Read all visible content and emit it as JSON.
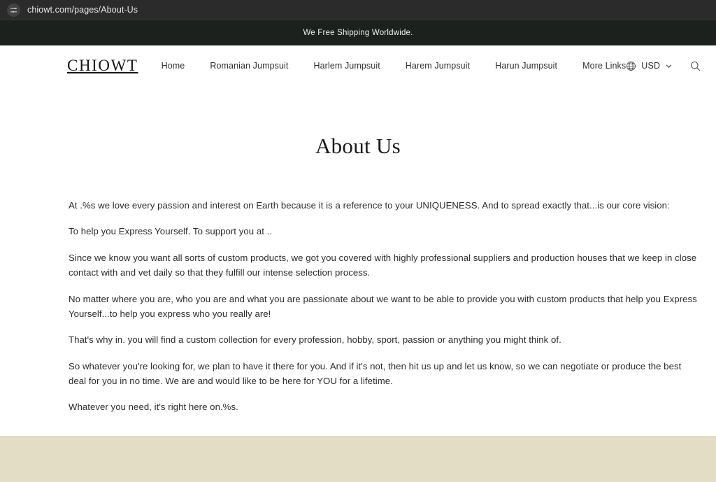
{
  "browser": {
    "url": "chiowt.com/pages/About-Us",
    "url_icon": "sliders-icon"
  },
  "announcement": {
    "text": "We Free Shipping Worldwide."
  },
  "header": {
    "logo": "CHIOWT",
    "nav": [
      {
        "label": "Home"
      },
      {
        "label": "Romanian Jumpsuit"
      },
      {
        "label": "Harlem Jumpsuit"
      },
      {
        "label": "Harem Jumpsuit"
      },
      {
        "label": "Harun Jumpsuit"
      },
      {
        "label": "More Links"
      }
    ],
    "currency": {
      "value": "USD",
      "globe_icon": "globe-icon",
      "chevron_icon": "chevron-down-icon"
    },
    "icons": {
      "search": "search-icon",
      "account": "account-icon",
      "cart": "cart-icon"
    }
  },
  "page": {
    "title": "About Us",
    "paragraphs": [
      "At .%s we love every passion and interest on Earth because it is a reference to your UNIQUENESS. And to spread exactly that...is our core vision:",
      "To help you Express Yourself. To support you at ..",
      "Since we know you want all sorts of custom products, we got you covered with highly professional suppliers and production houses that we keep in close contact with and vet daily so that they fulfill our intense selection process.",
      "No matter where you are, who you are and what you are passionate about we want to be able to provide you with custom products that help you Express Yourself...to help you express who you really are!",
      "That's why in. you will find a custom collection for every profession, hobby, sport, passion or anything you might think of.",
      "So whatever you're looking for, we plan to have it there for you. And if it's not, then hit us up and let us know, so we can negotiate or produce the best deal for you in no time. We are and would like to be here for YOU for a lifetime.",
      "Whatever you need, it's right here on.%s."
    ]
  },
  "colors": {
    "announcement_bg": "#1c211d",
    "footer_bg": "#e3ddc6",
    "browser_bg": "#2b2b2b",
    "text": "#2b2b2b"
  }
}
